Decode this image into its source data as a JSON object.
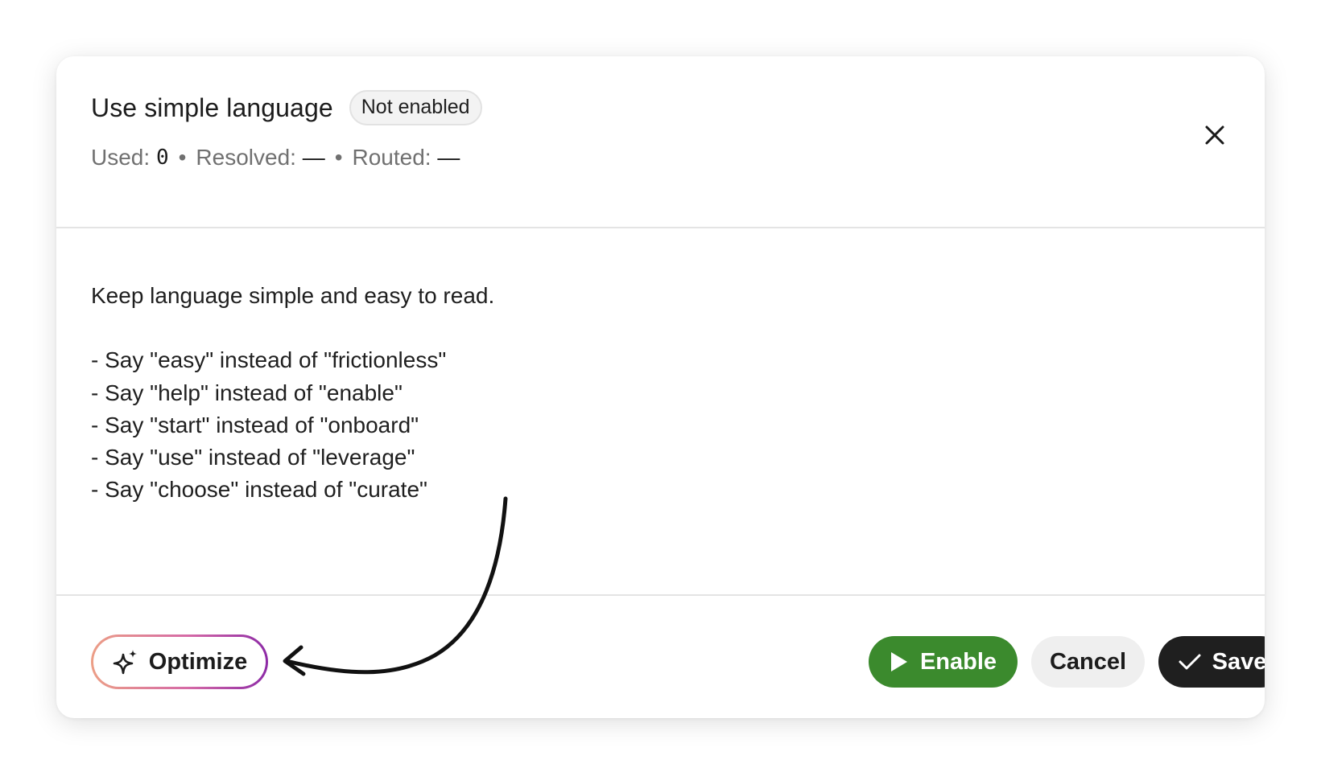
{
  "modal": {
    "title": "Use simple language",
    "status_badge": "Not enabled",
    "stats": {
      "used_label": "Used:",
      "used_value": "0",
      "resolved_label": "Resolved:",
      "resolved_value": "—",
      "routed_label": "Routed:",
      "routed_value": "—",
      "separator": "•"
    },
    "close_icon": "close-icon",
    "instructions": "Keep language simple and easy to read.\n\n- Say \"easy\" instead of \"frictionless\"\n- Say \"help\" instead of \"enable\"\n- Say \"start\" instead of \"onboard\"\n- Say \"use\" instead of \"leverage\"\n- Say \"choose\" instead of \"curate\""
  },
  "footer": {
    "optimize_label": "Optimize",
    "optimize_icon": "sparkle-icon",
    "enable_label": "Enable",
    "enable_icon": "play-icon",
    "cancel_label": "Cancel",
    "save_label": "Save",
    "save_icon": "check-icon"
  },
  "colors": {
    "enable_green": "#3b8a2d",
    "save_dark": "#1f1f1f",
    "cancel_gray": "#efefef",
    "optimize_gradient_start": "#ec9e86",
    "optimize_gradient_end": "#8d2aa6"
  }
}
